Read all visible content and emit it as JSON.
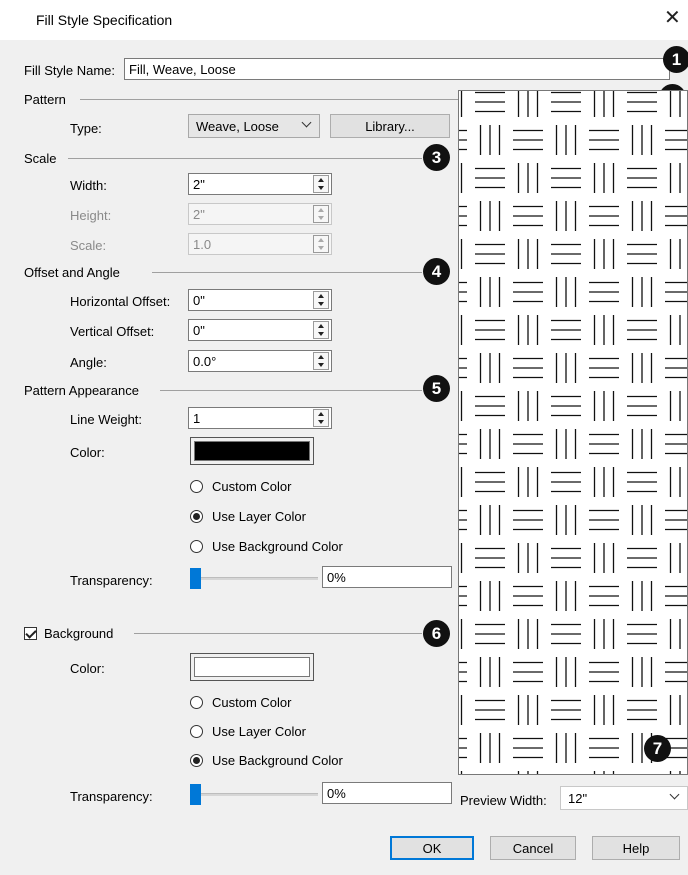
{
  "window": {
    "title": "Fill Style Specification"
  },
  "fill_style_name": {
    "label": "Fill Style Name:",
    "value": "Fill, Weave, Loose"
  },
  "pattern": {
    "section_label": "Pattern",
    "type_label": "Type:",
    "type_value": "Weave, Loose",
    "library_button": "Library..."
  },
  "scale": {
    "section_label": "Scale",
    "width_label": "Width:",
    "width_value": "2\"",
    "height_label": "Height:",
    "height_value": "2\"",
    "scale_label": "Scale:",
    "scale_value": "1.0"
  },
  "offset": {
    "section_label": "Offset and Angle",
    "h_label": "Horizontal Offset:",
    "h_value": "0\"",
    "v_label": "Vertical Offset:",
    "v_value": "0\"",
    "angle_label": "Angle:",
    "angle_value": "0.0°"
  },
  "appearance": {
    "section_label": "Pattern Appearance",
    "lw_label": "Line Weight:",
    "lw_value": "1",
    "color_label": "Color:",
    "color_value": "#000000",
    "radio_custom": "Custom Color",
    "radio_layer": "Use Layer Color",
    "radio_background": "Use Background Color",
    "selected": "layer",
    "transparency_label": "Transparency:",
    "transparency_value": "0%",
    "transparency_fraction": 0
  },
  "background": {
    "checkbox_label": "Background",
    "checked": true,
    "color_label": "Color:",
    "color_value": "#ffffff",
    "radio_custom": "Custom Color",
    "radio_layer": "Use Layer Color",
    "radio_background": "Use Background Color",
    "selected": "background",
    "transparency_label": "Transparency:",
    "transparency_value": "0%",
    "transparency_fraction": 0
  },
  "preview": {
    "width_label": "Preview Width:",
    "width_value": "12\""
  },
  "buttons": {
    "ok": "OK",
    "cancel": "Cancel",
    "help": "Help"
  },
  "callouts": [
    "1",
    "2",
    "3",
    "4",
    "5",
    "6",
    "7"
  ]
}
